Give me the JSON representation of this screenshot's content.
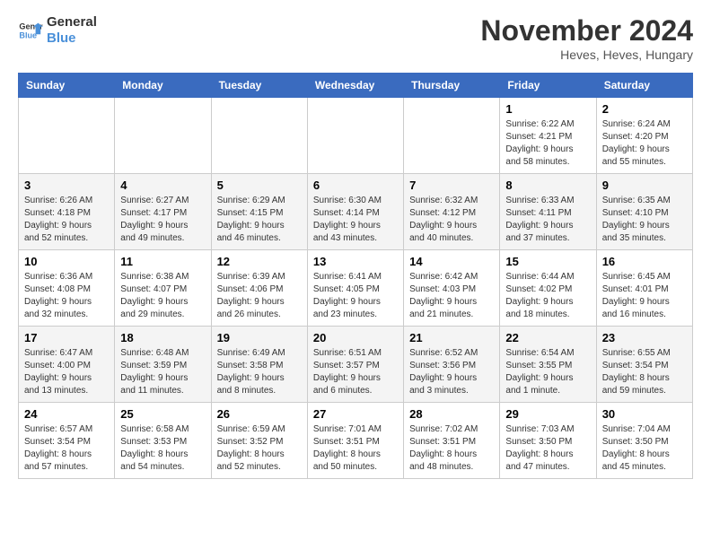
{
  "logo": {
    "line1": "General",
    "line2": "Blue"
  },
  "title": "November 2024",
  "subtitle": "Heves, Heves, Hungary",
  "days_of_week": [
    "Sunday",
    "Monday",
    "Tuesday",
    "Wednesday",
    "Thursday",
    "Friday",
    "Saturday"
  ],
  "weeks": [
    [
      {
        "day": "",
        "info": ""
      },
      {
        "day": "",
        "info": ""
      },
      {
        "day": "",
        "info": ""
      },
      {
        "day": "",
        "info": ""
      },
      {
        "day": "",
        "info": ""
      },
      {
        "day": "1",
        "info": "Sunrise: 6:22 AM\nSunset: 4:21 PM\nDaylight: 9 hours and 58 minutes."
      },
      {
        "day": "2",
        "info": "Sunrise: 6:24 AM\nSunset: 4:20 PM\nDaylight: 9 hours and 55 minutes."
      }
    ],
    [
      {
        "day": "3",
        "info": "Sunrise: 6:26 AM\nSunset: 4:18 PM\nDaylight: 9 hours and 52 minutes."
      },
      {
        "day": "4",
        "info": "Sunrise: 6:27 AM\nSunset: 4:17 PM\nDaylight: 9 hours and 49 minutes."
      },
      {
        "day": "5",
        "info": "Sunrise: 6:29 AM\nSunset: 4:15 PM\nDaylight: 9 hours and 46 minutes."
      },
      {
        "day": "6",
        "info": "Sunrise: 6:30 AM\nSunset: 4:14 PM\nDaylight: 9 hours and 43 minutes."
      },
      {
        "day": "7",
        "info": "Sunrise: 6:32 AM\nSunset: 4:12 PM\nDaylight: 9 hours and 40 minutes."
      },
      {
        "day": "8",
        "info": "Sunrise: 6:33 AM\nSunset: 4:11 PM\nDaylight: 9 hours and 37 minutes."
      },
      {
        "day": "9",
        "info": "Sunrise: 6:35 AM\nSunset: 4:10 PM\nDaylight: 9 hours and 35 minutes."
      }
    ],
    [
      {
        "day": "10",
        "info": "Sunrise: 6:36 AM\nSunset: 4:08 PM\nDaylight: 9 hours and 32 minutes."
      },
      {
        "day": "11",
        "info": "Sunrise: 6:38 AM\nSunset: 4:07 PM\nDaylight: 9 hours and 29 minutes."
      },
      {
        "day": "12",
        "info": "Sunrise: 6:39 AM\nSunset: 4:06 PM\nDaylight: 9 hours and 26 minutes."
      },
      {
        "day": "13",
        "info": "Sunrise: 6:41 AM\nSunset: 4:05 PM\nDaylight: 9 hours and 23 minutes."
      },
      {
        "day": "14",
        "info": "Sunrise: 6:42 AM\nSunset: 4:03 PM\nDaylight: 9 hours and 21 minutes."
      },
      {
        "day": "15",
        "info": "Sunrise: 6:44 AM\nSunset: 4:02 PM\nDaylight: 9 hours and 18 minutes."
      },
      {
        "day": "16",
        "info": "Sunrise: 6:45 AM\nSunset: 4:01 PM\nDaylight: 9 hours and 16 minutes."
      }
    ],
    [
      {
        "day": "17",
        "info": "Sunrise: 6:47 AM\nSunset: 4:00 PM\nDaylight: 9 hours and 13 minutes."
      },
      {
        "day": "18",
        "info": "Sunrise: 6:48 AM\nSunset: 3:59 PM\nDaylight: 9 hours and 11 minutes."
      },
      {
        "day": "19",
        "info": "Sunrise: 6:49 AM\nSunset: 3:58 PM\nDaylight: 9 hours and 8 minutes."
      },
      {
        "day": "20",
        "info": "Sunrise: 6:51 AM\nSunset: 3:57 PM\nDaylight: 9 hours and 6 minutes."
      },
      {
        "day": "21",
        "info": "Sunrise: 6:52 AM\nSunset: 3:56 PM\nDaylight: 9 hours and 3 minutes."
      },
      {
        "day": "22",
        "info": "Sunrise: 6:54 AM\nSunset: 3:55 PM\nDaylight: 9 hours and 1 minute."
      },
      {
        "day": "23",
        "info": "Sunrise: 6:55 AM\nSunset: 3:54 PM\nDaylight: 8 hours and 59 minutes."
      }
    ],
    [
      {
        "day": "24",
        "info": "Sunrise: 6:57 AM\nSunset: 3:54 PM\nDaylight: 8 hours and 57 minutes."
      },
      {
        "day": "25",
        "info": "Sunrise: 6:58 AM\nSunset: 3:53 PM\nDaylight: 8 hours and 54 minutes."
      },
      {
        "day": "26",
        "info": "Sunrise: 6:59 AM\nSunset: 3:52 PM\nDaylight: 8 hours and 52 minutes."
      },
      {
        "day": "27",
        "info": "Sunrise: 7:01 AM\nSunset: 3:51 PM\nDaylight: 8 hours and 50 minutes."
      },
      {
        "day": "28",
        "info": "Sunrise: 7:02 AM\nSunset: 3:51 PM\nDaylight: 8 hours and 48 minutes."
      },
      {
        "day": "29",
        "info": "Sunrise: 7:03 AM\nSunset: 3:50 PM\nDaylight: 8 hours and 47 minutes."
      },
      {
        "day": "30",
        "info": "Sunrise: 7:04 AM\nSunset: 3:50 PM\nDaylight: 8 hours and 45 minutes."
      }
    ]
  ]
}
